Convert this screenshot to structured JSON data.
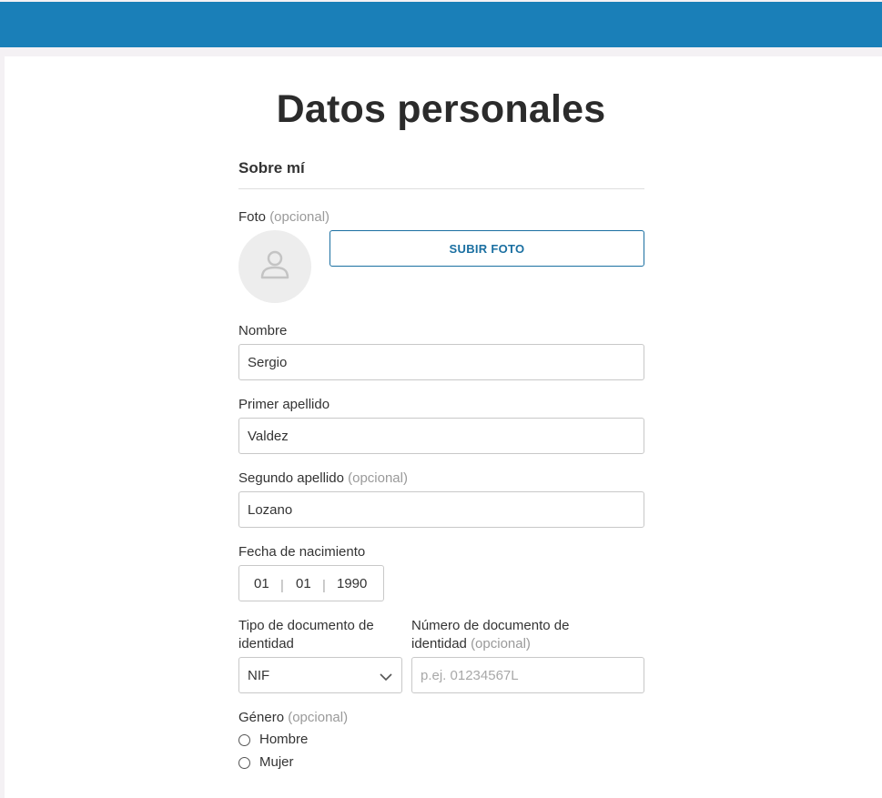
{
  "page": {
    "title": "Datos personales",
    "section_title": "Sobre mí"
  },
  "photo": {
    "label": "Foto",
    "optional": "(opcional)",
    "upload_button": "SUBIR FOTO",
    "avatar_icon": "user-placeholder-icon"
  },
  "fields": {
    "nombre": {
      "label": "Nombre",
      "value": "Sergio"
    },
    "primer_apellido": {
      "label": "Primer apellido",
      "value": "Valdez"
    },
    "segundo_apellido": {
      "label": "Segundo apellido",
      "optional": "(opcional)",
      "value": "Lozano"
    },
    "fecha_nacimiento": {
      "label": "Fecha de nacimiento",
      "day": "01",
      "month": "01",
      "year": "1990",
      "separator": "|"
    },
    "tipo_documento": {
      "label_line1": "Tipo de documento de",
      "label_line2": "identidad",
      "value": "NIF"
    },
    "numero_documento": {
      "label_line1": "Número de documento de",
      "label_line2": "identidad",
      "optional": "(opcional)",
      "placeholder": "p.ej. 01234567L"
    },
    "genero": {
      "label": "Género",
      "optional": "(opcional)",
      "options": [
        "Hombre",
        "Mujer"
      ]
    }
  },
  "colors": {
    "header": "#1a7fb8",
    "accent": "#1a6fa1"
  }
}
